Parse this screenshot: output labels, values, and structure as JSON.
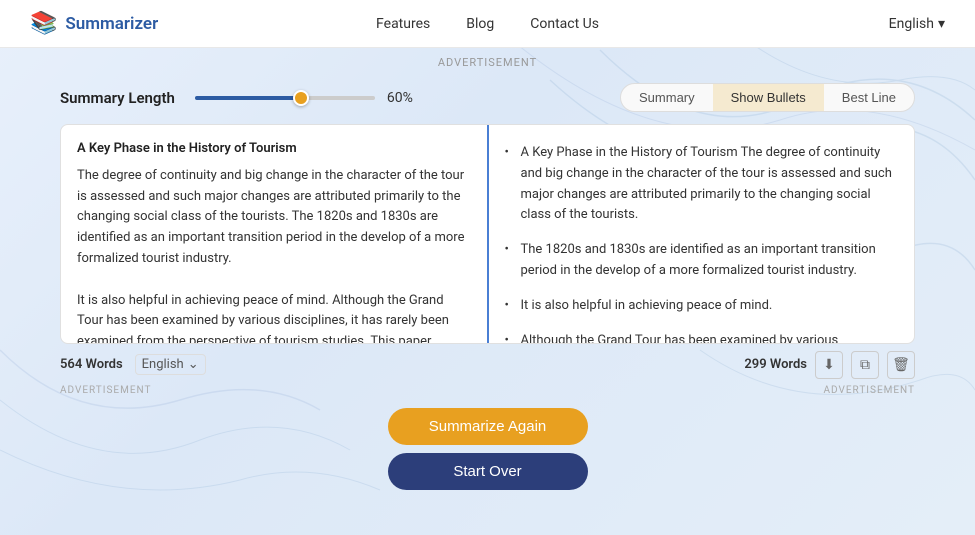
{
  "header": {
    "logo_icon": "📚",
    "logo_text": "Summarizer",
    "nav": [
      {
        "label": "Features",
        "id": "features"
      },
      {
        "label": "Blog",
        "id": "blog"
      },
      {
        "label": "Contact Us",
        "id": "contact"
      }
    ],
    "language": "English",
    "language_arrow": "▾"
  },
  "ad_banner_top": "ADVERTISEMENT",
  "controls": {
    "summary_length_label": "Summary Length",
    "slider_value": 60,
    "slider_percent": "60%",
    "tabs": [
      {
        "label": "Summary",
        "id": "summary",
        "active": false
      },
      {
        "label": "Show Bullets",
        "id": "bullets",
        "active": true
      },
      {
        "label": "Best Line",
        "id": "bestline",
        "active": false
      }
    ]
  },
  "left_panel": {
    "title": "A Key Phase in the History of Tourism",
    "text": "The degree of continuity and big change in the character of the tour is assessed and such major changes are attributed primarily to the changing social class of the tourists. The 1820s and 1830s are identified as an important transition period in the develop of a more formalized tourist industry.\nIt is also helpful in achieving peace of mind. Although the Grand Tour has been examined by various disciplines, it has rarely been examined from the perspective of tourism studies. This paper begins with a review of previous work and concepts about the tour and then outlines some of its principal features based on an analysis of the primary sources of information: the diaries, letters, and journals of the travelers. Four aspects of the Grand Tour are then examined: the tourists, spatial and temporal"
  },
  "right_panel": {
    "bullets": [
      "A Key Phase in the History of Tourism The degree of continuity and big change in the character of the tour is assessed and such major changes are attributed primarily to the changing social class of the tourists.",
      "The 1820s and 1830s are identified as an important transition period in the develop of a more formalized tourist industry.",
      "It is also helpful in achieving peace of mind.",
      "Although the Grand Tour has been examined by various disciplines, it has rarely been examined from the perspective of tourism studies."
    ]
  },
  "left_footer": {
    "word_count": "564 Words",
    "language": "English",
    "lang_arrow": "⌄"
  },
  "right_footer": {
    "word_count": "299 Words",
    "download_icon": "⬇",
    "copy_icon": "⧉",
    "delete_icon": "🗑"
  },
  "ad_labels": {
    "left": "ADVERTISEMENT",
    "right": "ADVERTISEMENT"
  },
  "buttons": {
    "summarize_again": "Summarize Again",
    "start_over": "Start Over"
  }
}
